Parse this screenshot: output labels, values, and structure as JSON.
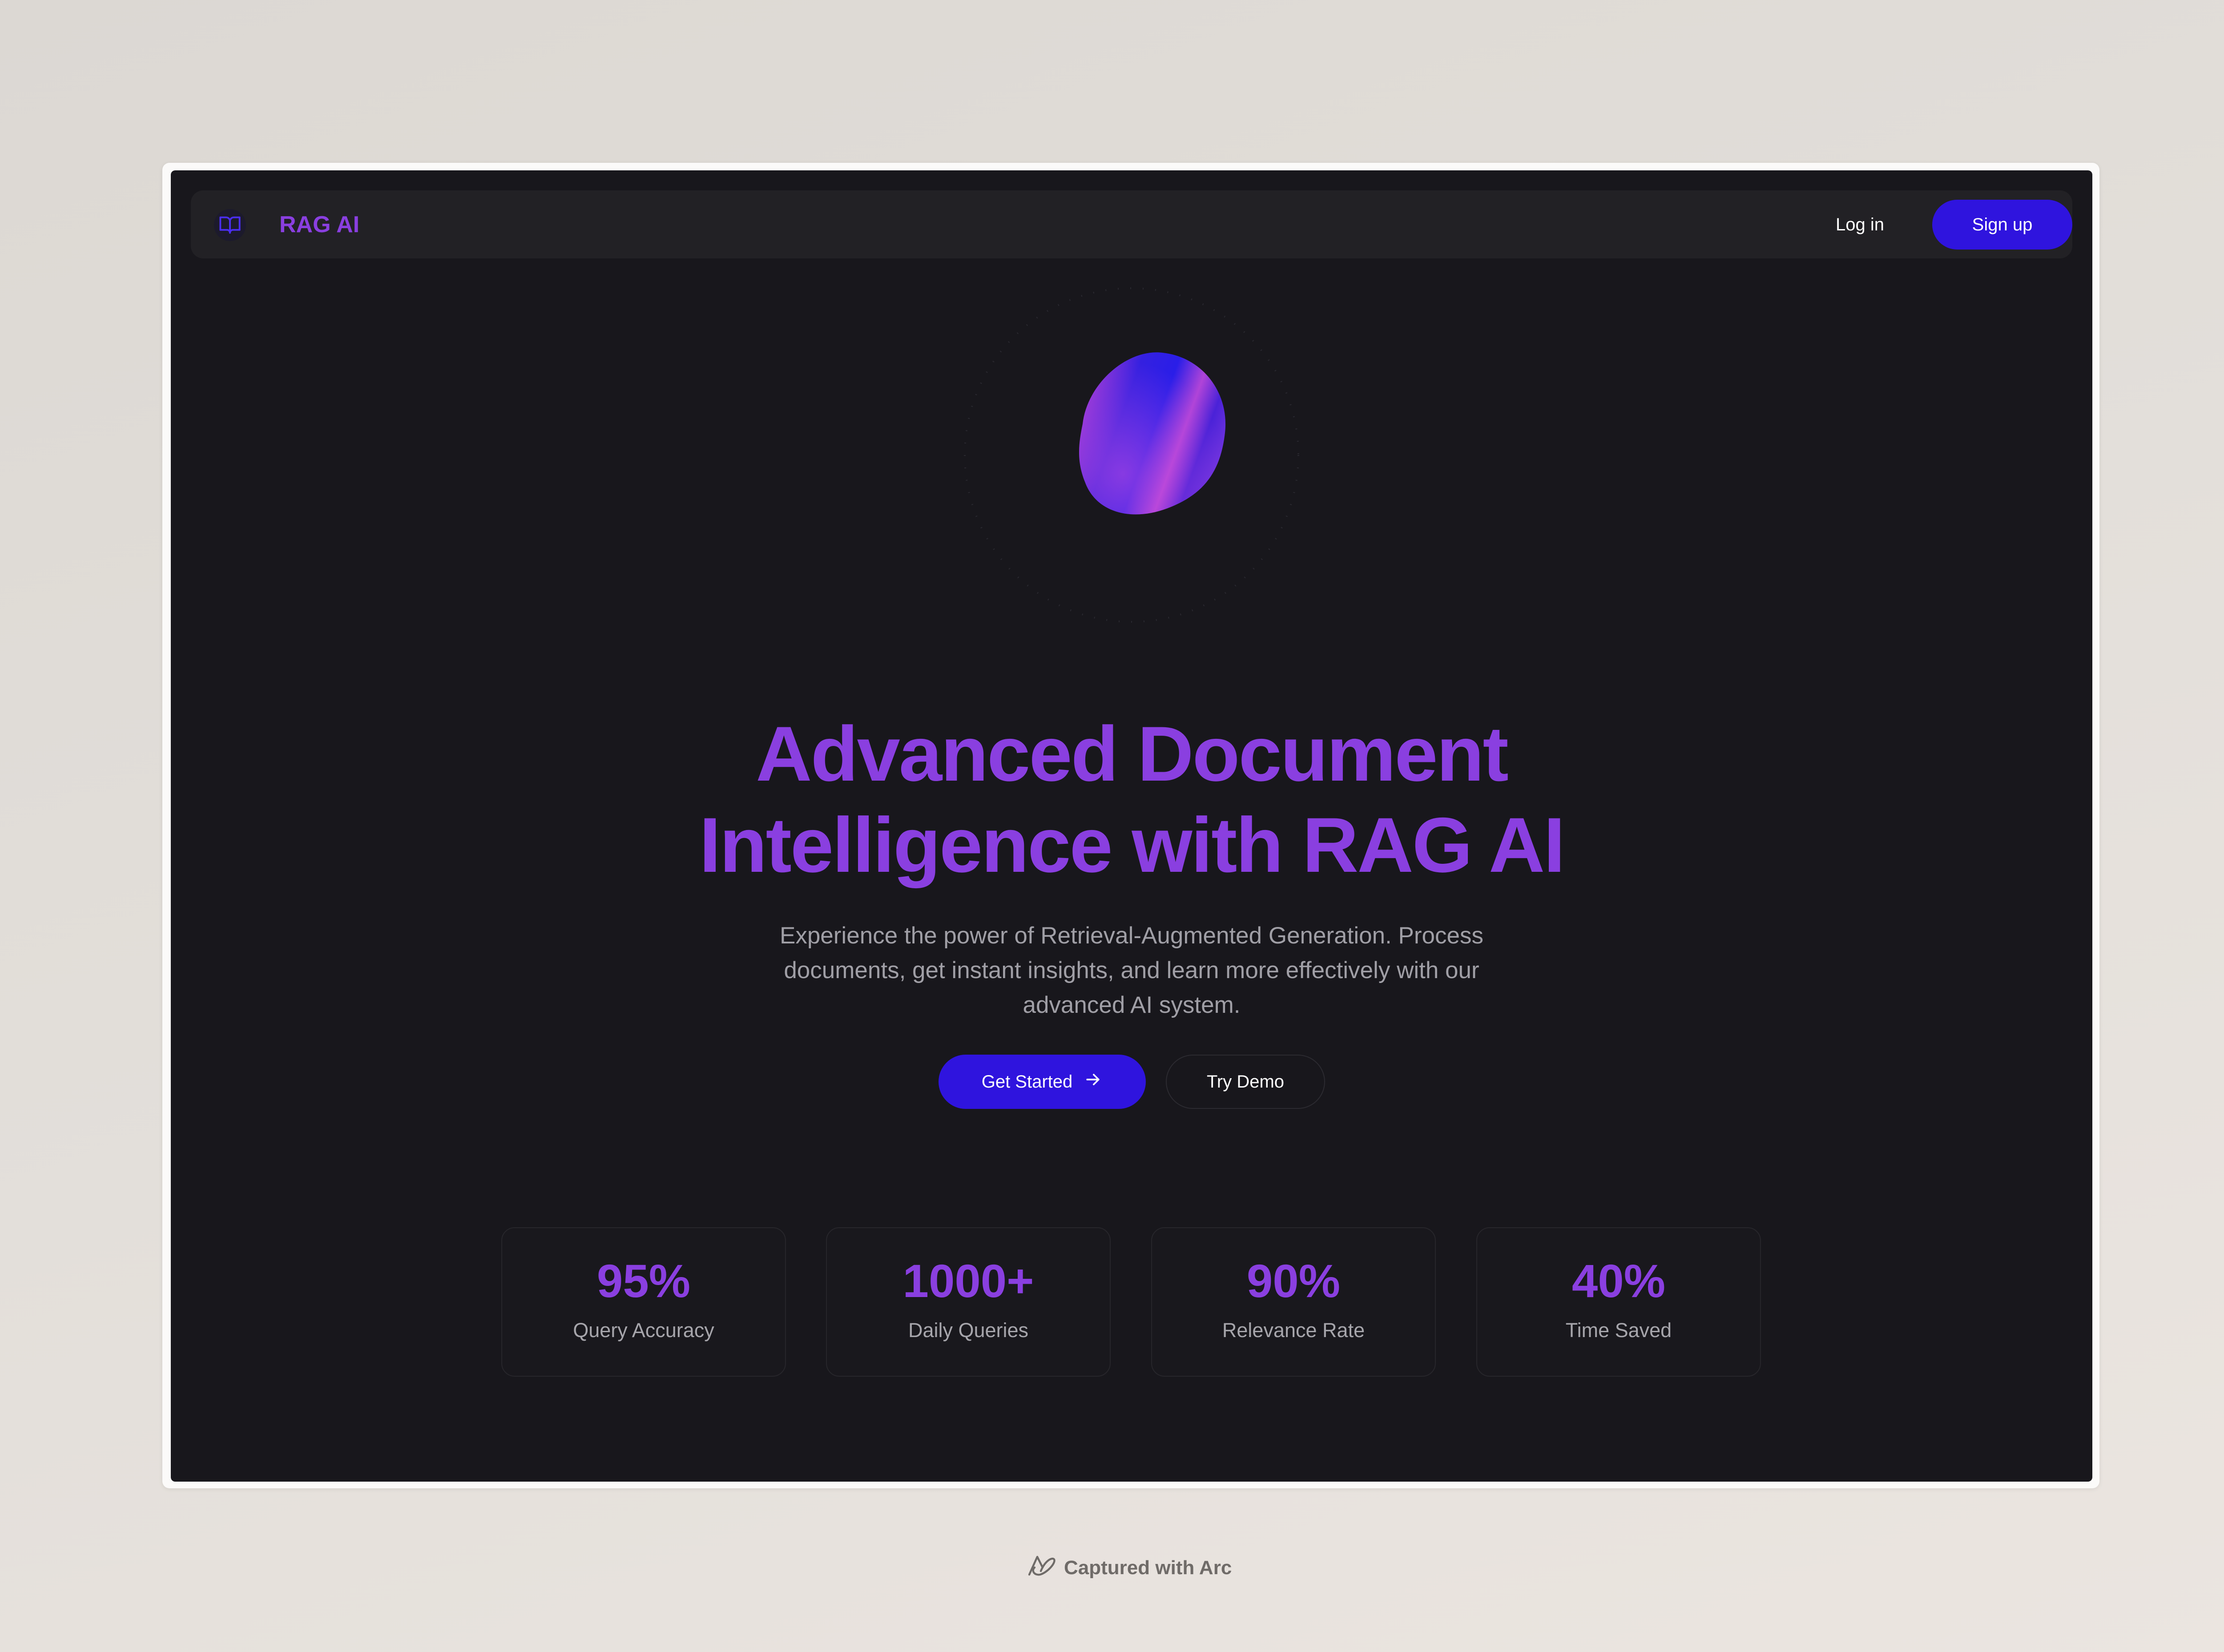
{
  "nav": {
    "brand": "RAG AI",
    "login_label": "Log in",
    "signup_label": "Sign up"
  },
  "hero": {
    "headline_line1": "Advanced Document",
    "headline_line2": "Intelligence with RAG AI",
    "subtitle": "Experience the power of Retrieval-Augmented Generation. Process documents, get instant insights, and learn more effectively with our advanced AI system.",
    "primary_cta": "Get Started",
    "secondary_cta": "Try Demo"
  },
  "stats": [
    {
      "value": "95%",
      "label": "Query Accuracy"
    },
    {
      "value": "1000+",
      "label": "Daily Queries"
    },
    {
      "value": "90%",
      "label": "Relevance Rate"
    },
    {
      "value": "40%",
      "label": "Time Saved"
    }
  ],
  "footer": {
    "captured_text": "Captured with Arc"
  },
  "icons": {
    "brand": "book-open-icon",
    "cta_arrow": "arrow-right-icon",
    "arc_logo": "arc-logo-icon"
  },
  "colors": {
    "accent_purple": "#8a3fe0",
    "primary_blue": "#2f14de",
    "background": "#18171c"
  }
}
